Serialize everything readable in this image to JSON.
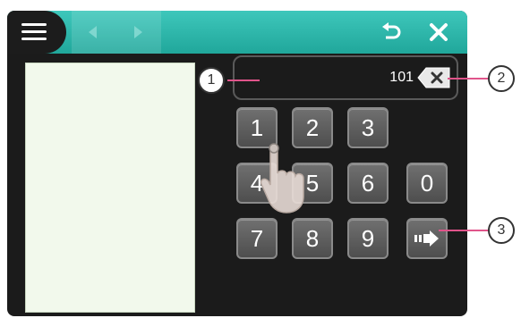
{
  "topbar": {
    "menu_icon": "hamburger-menu-icon",
    "back_icon": "arrow-left-icon",
    "forward_icon": "arrow-right-icon",
    "undo_icon": "undo-icon",
    "close_icon": "close-icon",
    "accent_color": "#2fb8ab"
  },
  "display": {
    "value": "101",
    "backspace_icon": "backspace-icon"
  },
  "keypad": {
    "keys": [
      "1",
      "2",
      "3",
      "4",
      "5",
      "6",
      "0",
      "7",
      "8",
      "9"
    ],
    "enter_icon": "enter-arrow-icon"
  },
  "callouts": {
    "c1": "1",
    "c2": "2",
    "c3": "3",
    "line_color": "#e0548a"
  }
}
